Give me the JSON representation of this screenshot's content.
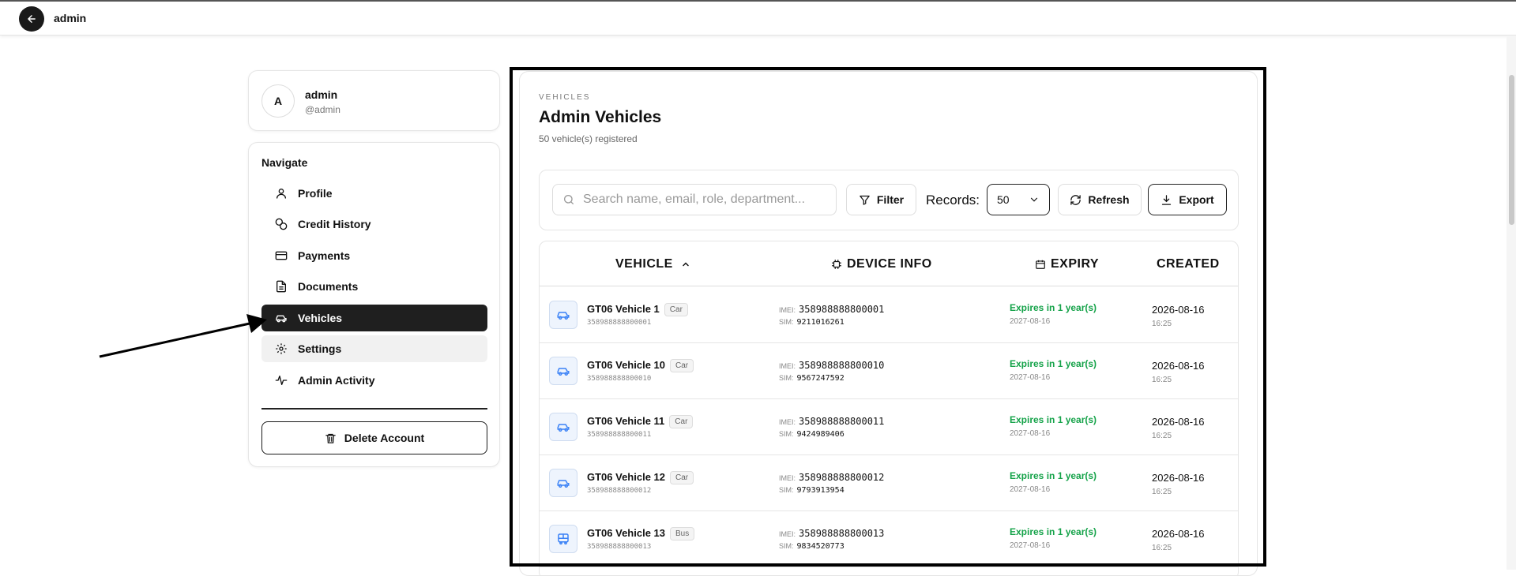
{
  "topbar": {
    "title": "admin"
  },
  "profile": {
    "avatar_letter": "A",
    "name": "admin",
    "handle": "@admin"
  },
  "nav": {
    "heading": "Navigate",
    "items": [
      {
        "label": "Profile",
        "icon": "user-icon"
      },
      {
        "label": "Credit History",
        "icon": "coins-icon"
      },
      {
        "label": "Payments",
        "icon": "credit-card-icon"
      },
      {
        "label": "Documents",
        "icon": "document-icon"
      },
      {
        "label": "Vehicles",
        "icon": "car-icon"
      },
      {
        "label": "Settings",
        "icon": "gear-icon"
      },
      {
        "label": "Admin Activity",
        "icon": "activity-icon"
      }
    ],
    "active": "Vehicles",
    "delete_label": "Delete Account"
  },
  "main": {
    "eyebrow": "VEHICLES",
    "title": "Admin Vehicles",
    "subtitle": "50 vehicle(s) registered"
  },
  "toolbar": {
    "search_placeholder": "Search name, email, role, department...",
    "filter_label": "Filter",
    "records_label": "Records:",
    "records_value": "50",
    "refresh_label": "Refresh",
    "export_label": "Export"
  },
  "table": {
    "columns": {
      "vehicle": "VEHICLE",
      "device": "DEVICE INFO",
      "expiry": "EXPIRY",
      "created": "CREATED"
    },
    "imei_label": "IMEI:",
    "sim_label": "SIM:",
    "rows": [
      {
        "name": "GT06 Vehicle 1",
        "type": "Car",
        "imei": "358988888800001",
        "sim": "9211016261",
        "expiry_status": "Expires in 1 year(s)",
        "expiry_date": "2027-08-16",
        "created_date": "2026-08-16",
        "created_time": "16:25",
        "icon": "car-icon"
      },
      {
        "name": "GT06 Vehicle 10",
        "type": "Car",
        "imei": "358988888800010",
        "sim": "9567247592",
        "expiry_status": "Expires in 1 year(s)",
        "expiry_date": "2027-08-16",
        "created_date": "2026-08-16",
        "created_time": "16:25",
        "icon": "car-icon"
      },
      {
        "name": "GT06 Vehicle 11",
        "type": "Car",
        "imei": "358988888800011",
        "sim": "9424989406",
        "expiry_status": "Expires in 1 year(s)",
        "expiry_date": "2027-08-16",
        "created_date": "2026-08-16",
        "created_time": "16:25",
        "icon": "car-icon"
      },
      {
        "name": "GT06 Vehicle 12",
        "type": "Car",
        "imei": "358988888800012",
        "sim": "9793913954",
        "expiry_status": "Expires in 1 year(s)",
        "expiry_date": "2027-08-16",
        "created_date": "2026-08-16",
        "created_time": "16:25",
        "icon": "car-icon"
      },
      {
        "name": "GT06 Vehicle 13",
        "type": "Bus",
        "imei": "358988888800013",
        "sim": "9834520773",
        "expiry_status": "Expires in 1 year(s)",
        "expiry_date": "2027-08-16",
        "created_date": "2026-08-16",
        "created_time": "16:25",
        "icon": "bus-icon"
      }
    ]
  },
  "colors": {
    "accent_dark": "#1f1f1f",
    "expiry_green": "#16a34a",
    "vehicle_icon_blue": "#3b82f6"
  }
}
